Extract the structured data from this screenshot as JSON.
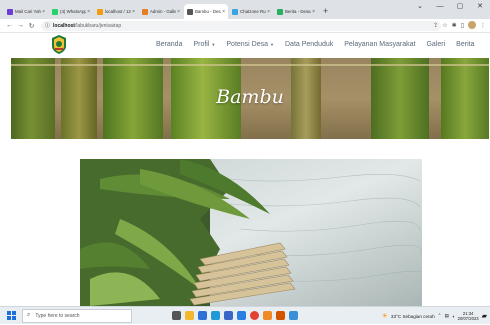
{
  "browser": {
    "tabs": [
      {
        "label": "Mail Cari Yahoo",
        "color": "#6b3fd1",
        "active": false
      },
      {
        "label": "(4) WhatsApp",
        "color": "#25d366",
        "active": false
      },
      {
        "label": "localhost / 127.0.",
        "color": "#f39c12",
        "active": false
      },
      {
        "label": "Admin - Gallery",
        "color": "#e67e22",
        "active": false
      },
      {
        "label": "Bambu - Desa L",
        "color": "#555555",
        "active": true
      },
      {
        "label": "Chatzone Rumah",
        "color": "#3aa3e3",
        "active": false
      },
      {
        "label": "Berita - Desa Ka",
        "color": "#27ae60",
        "active": false
      }
    ],
    "new_tab": "+",
    "window_controls": [
      "⌄",
      "—",
      "▢",
      "✕"
    ],
    "url_host": "localhost",
    "url_path": "/labukbaru/jenisairap"
  },
  "site": {
    "menu": [
      {
        "label": "Beranda",
        "dropdown": false
      },
      {
        "label": "Profil",
        "dropdown": true
      },
      {
        "label": "Potensi Desa",
        "dropdown": true
      },
      {
        "label": "Data Penduduk",
        "dropdown": false
      },
      {
        "label": "Pelayanan Masyarakat",
        "dropdown": false
      },
      {
        "label": "Galeri",
        "dropdown": false
      },
      {
        "label": "Berita",
        "dropdown": false
      }
    ],
    "hero_title": "Bambu"
  },
  "taskbar": {
    "search_placeholder": "Type here to search",
    "weather": "33°C  Sebagian cerah",
    "time": "21:34",
    "date": "20/07/2023"
  }
}
